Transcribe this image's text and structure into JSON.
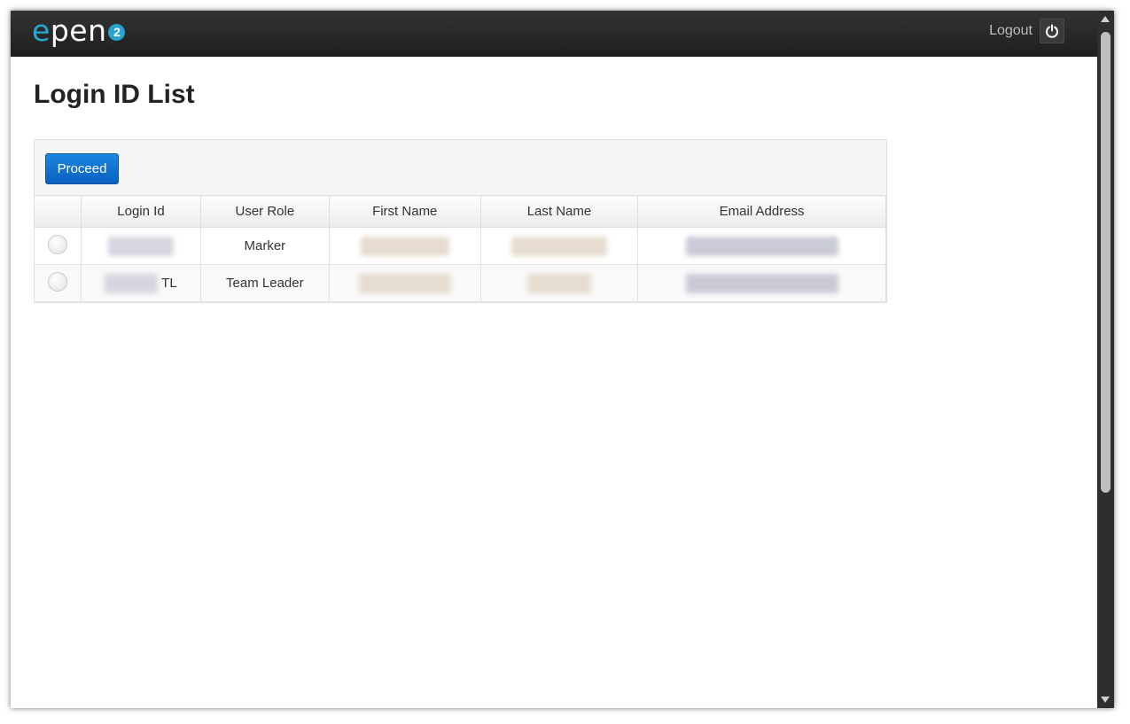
{
  "app": {
    "logo_text": "epen",
    "logo_badge": "2",
    "logout_label": "Logout"
  },
  "page": {
    "title": "Login ID List"
  },
  "toolbar": {
    "proceed_label": "Proceed"
  },
  "table": {
    "columns": [
      "Login Id",
      "User Role",
      "First Name",
      "Last Name",
      "Email Address"
    ],
    "rows": [
      {
        "login_suffix": "",
        "user_role": "Marker"
      },
      {
        "login_suffix": "TL",
        "user_role": "Team Leader"
      }
    ]
  },
  "colors": {
    "topbar": "#2a2a2a",
    "logo_accent": "#28a7d6",
    "button": "#0b6fd1"
  }
}
